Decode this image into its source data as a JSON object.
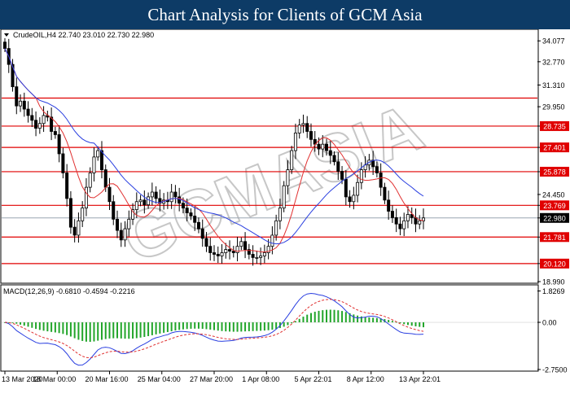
{
  "page_title": "Chart Analysis for Clients of GCM Asia",
  "watermark": "GCMASIA",
  "colors": {
    "accent": "#0d3b66",
    "level": "#e00000",
    "ma_fast": "#e03030",
    "ma_slow": "#2a3fe0",
    "candle": "#000000",
    "macd_hist": "#22a52a",
    "current_price": "#9aa6b2"
  },
  "chart_data": {
    "type": "candlestick",
    "header": {
      "symbol": "CrudeOIL,H4",
      "open": "22.740",
      "high": "23.010",
      "low": "22.730",
      "close": "22.980"
    },
    "price_axis": {
      "ylim": [
        18.99,
        34.7
      ],
      "ticks": [
        34.077,
        32.77,
        31.31,
        29.95,
        28.735,
        27.401,
        25.878,
        24.45,
        23.769,
        22.98,
        21.781,
        20.12,
        18.99
      ]
    },
    "support_resistance_levels": [
      30.493,
      28.735,
      27.401,
      25.878,
      23.769,
      21.781,
      20.12
    ],
    "current_price": 22.98,
    "x_labels": [
      "13 Mar 2020",
      "18 Mar 00:00",
      "20 Mar 16:00",
      "25 Mar 04:00",
      "27 Mar 20:00",
      "1 Apr 08:00",
      "5 Apr 22:01",
      "8 Apr 12:00",
      "13 Apr 22:01"
    ],
    "close_series": [
      33.6,
      32.6,
      31.2,
      30.0,
      30.3,
      29.8,
      29.4,
      29.1,
      28.6,
      28.9,
      29.4,
      29.3,
      28.4,
      28.2,
      27.0,
      25.8,
      24.2,
      22.4,
      21.9,
      22.8,
      23.6,
      24.9,
      25.8,
      26.8,
      27.2,
      26.0,
      24.9,
      24.0,
      22.9,
      22.2,
      21.6,
      22.3,
      22.9,
      23.5,
      24.0,
      24.1,
      23.8,
      24.3,
      24.6,
      24.2,
      23.9,
      24.1,
      24.0,
      24.6,
      24.3,
      23.9,
      23.6,
      23.3,
      23.1,
      22.7,
      22.3,
      21.7,
      21.2,
      20.8,
      20.7,
      20.6,
      20.8,
      21.0,
      20.9,
      20.8,
      21.2,
      21.5,
      21.0,
      20.7,
      20.5,
      20.5,
      20.6,
      20.8,
      21.2,
      21.9,
      22.8,
      23.6,
      25.0,
      26.0,
      27.2,
      28.3,
      28.8,
      28.9,
      28.4,
      27.9,
      27.6,
      27.3,
      27.6,
      27.2,
      26.9,
      26.5,
      25.9,
      25.4,
      24.3,
      24.0,
      24.4,
      25.2,
      26.0,
      26.3,
      26.6,
      26.2,
      25.8,
      24.9,
      24.1,
      23.4,
      23.0,
      22.6,
      22.3,
      22.8,
      23.2,
      23.0,
      22.6,
      22.8,
      22.98
    ],
    "ma_fast_label": "",
    "ma_slow_label": "",
    "macd": {
      "label": "MACD(12,26,9) -0.6810 -0.4594 -0.2216",
      "ylim": [
        -2.75,
        1.9
      ],
      "ticks": [
        1.8269,
        0.0,
        -2.75
      ]
    }
  }
}
